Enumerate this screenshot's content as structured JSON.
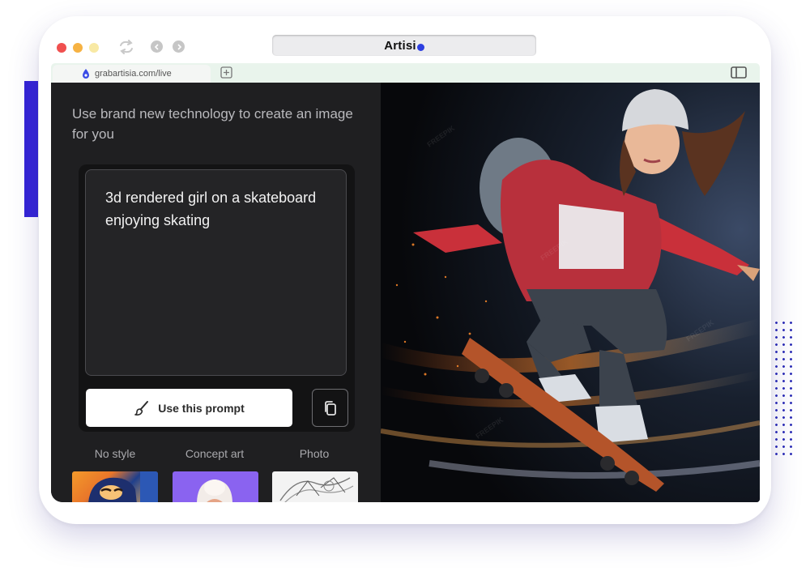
{
  "browser": {
    "brand": "Artisi",
    "tab_url": "grabartisia.com/live"
  },
  "panel": {
    "headline": "Use brand new technology to create an image for you",
    "prompt_text": "3d rendered girl on a skateboard enjoying skating",
    "use_prompt_label": "Use this prompt"
  },
  "styles": [
    {
      "label": "No style"
    },
    {
      "label": "Concept art"
    },
    {
      "label": "Photo"
    }
  ],
  "colors": {
    "accent": "#3323d6",
    "panel_bg": "#1f1f21",
    "button_bg": "#ffffff"
  },
  "hero": {
    "watermark": "FREEPIK"
  }
}
